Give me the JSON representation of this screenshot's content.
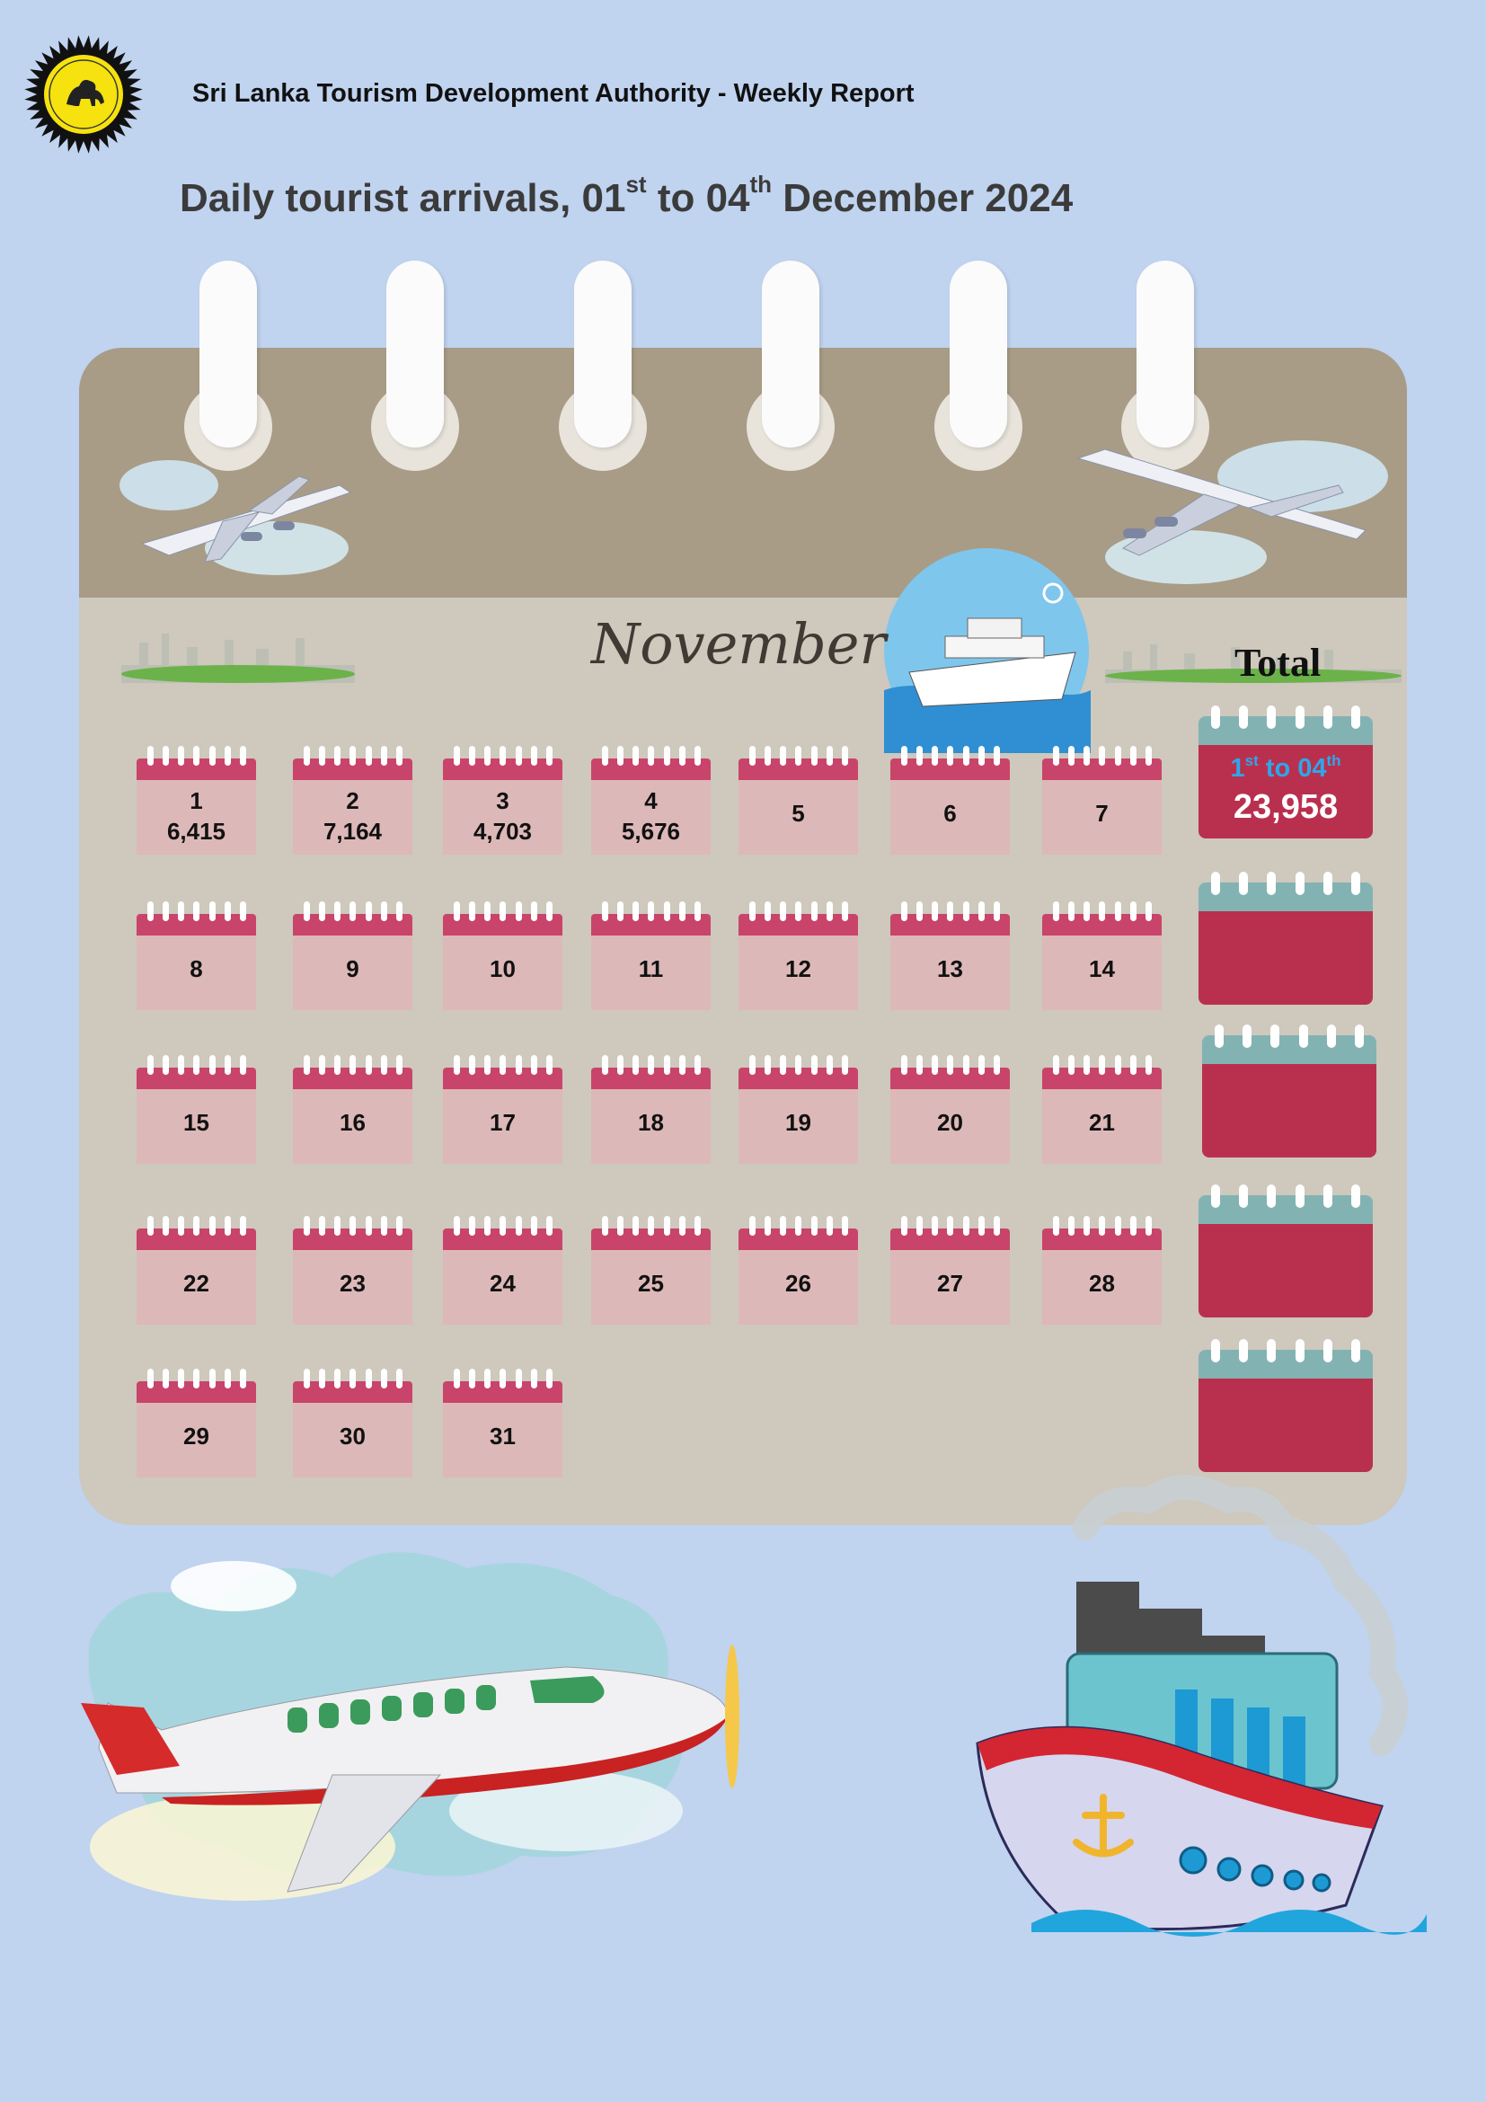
{
  "header": {
    "org_title": "Sri Lanka Tourism Development Authority - Weekly Report",
    "title_part1": "Daily tourist arrivals, 01",
    "title_sup1": "st",
    "title_part2": " to 04",
    "title_sup2": "th",
    "title_part3": " December 2024"
  },
  "calendar": {
    "month": "November",
    "total_label": "Total",
    "days": [
      {
        "day": "1",
        "value": "6,415"
      },
      {
        "day": "2",
        "value": "7,164"
      },
      {
        "day": "3",
        "value": "4,703"
      },
      {
        "day": "4",
        "value": "5,676"
      },
      {
        "day": "5",
        "value": ""
      },
      {
        "day": "6",
        "value": ""
      },
      {
        "day": "7",
        "value": ""
      },
      {
        "day": "8",
        "value": ""
      },
      {
        "day": "9",
        "value": ""
      },
      {
        "day": "10",
        "value": ""
      },
      {
        "day": "11",
        "value": ""
      },
      {
        "day": "12",
        "value": ""
      },
      {
        "day": "13",
        "value": ""
      },
      {
        "day": "14",
        "value": ""
      },
      {
        "day": "15",
        "value": ""
      },
      {
        "day": "16",
        "value": ""
      },
      {
        "day": "17",
        "value": ""
      },
      {
        "day": "18",
        "value": ""
      },
      {
        "day": "19",
        "value": ""
      },
      {
        "day": "20",
        "value": ""
      },
      {
        "day": "21",
        "value": ""
      },
      {
        "day": "22",
        "value": ""
      },
      {
        "day": "23",
        "value": ""
      },
      {
        "day": "24",
        "value": ""
      },
      {
        "day": "25",
        "value": ""
      },
      {
        "day": "26",
        "value": ""
      },
      {
        "day": "27",
        "value": ""
      },
      {
        "day": "28",
        "value": ""
      },
      {
        "day": "29",
        "value": ""
      },
      {
        "day": "30",
        "value": ""
      },
      {
        "day": "31",
        "value": ""
      }
    ],
    "totals": [
      {
        "range_a": "1",
        "range_a_sup": "st",
        "range_mid": " to 04",
        "range_b_sup": "th",
        "total": "23,958"
      },
      {
        "range_a": "",
        "range_a_sup": "",
        "range_mid": "",
        "range_b_sup": "",
        "total": ""
      },
      {
        "range_a": "",
        "range_a_sup": "",
        "range_mid": "",
        "range_b_sup": "",
        "total": ""
      },
      {
        "range_a": "",
        "range_a_sup": "",
        "range_mid": "",
        "range_b_sup": "",
        "total": ""
      },
      {
        "range_a": "",
        "range_a_sup": "",
        "range_mid": "",
        "range_b_sup": "",
        "total": ""
      }
    ]
  },
  "colors": {
    "background": "#c0d3ef",
    "day_header": "#c8446a",
    "day_page": "#ddb8b8",
    "total_header": "#82b3b2",
    "total_page": "#b9304f",
    "range_text": "#2fa6e8"
  },
  "icons": [
    "emblem-logo",
    "airplane-icon",
    "cruise-ship-icon",
    "cartoon-airplane-icon",
    "cartoon-ship-icon"
  ]
}
